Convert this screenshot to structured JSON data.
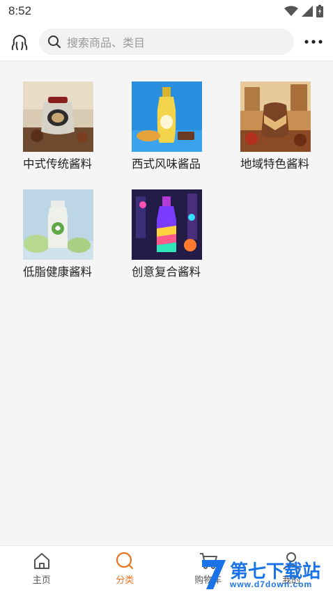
{
  "status_bar": {
    "time": "8:52"
  },
  "header": {
    "search_placeholder": "搜索商品、类目"
  },
  "categories": [
    {
      "label": "中式传统酱料"
    },
    {
      "label": "西式风味酱品"
    },
    {
      "label": "地域特色酱料"
    },
    {
      "label": "低脂健康酱料"
    },
    {
      "label": "创意复合酱料"
    }
  ],
  "tabbar": {
    "tabs": [
      {
        "label": "主页",
        "icon": "home-icon"
      },
      {
        "label": "分类",
        "icon": "category-icon",
        "active": true
      },
      {
        "label": "购物车",
        "icon": "cart-icon"
      },
      {
        "label": "我的",
        "icon": "user-icon"
      }
    ]
  },
  "watermark": {
    "brand": "第七下载站",
    "url": "www.d7down.com"
  },
  "colors": {
    "accent": "#e8731f",
    "watermark_blue": "#1a73e8"
  }
}
